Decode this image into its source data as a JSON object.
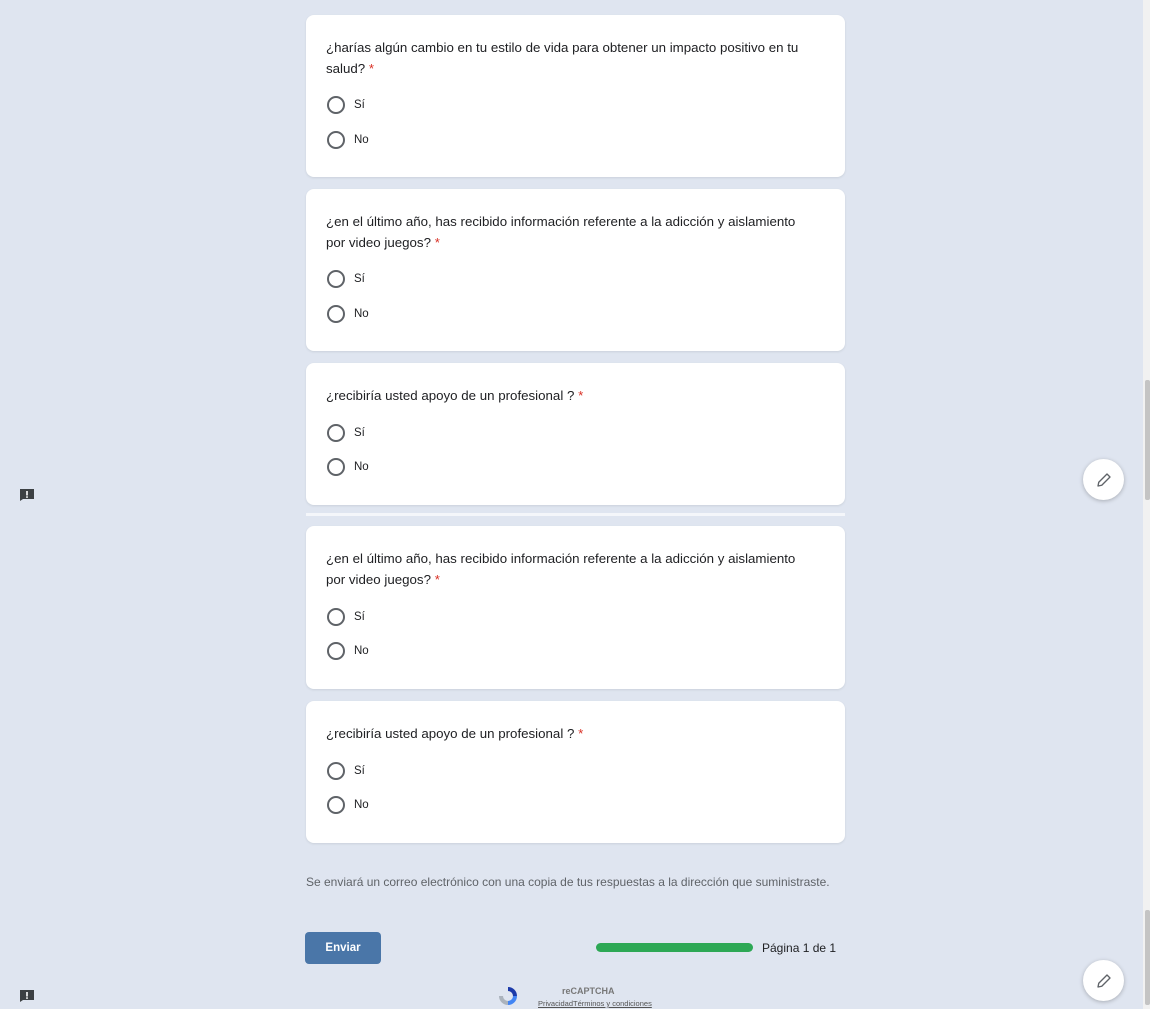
{
  "questions": [
    {
      "title": "¿harías algún cambio en tu estilo de vida para obtener un impacto positivo en tu salud?",
      "required_mark": "*",
      "options": [
        "Sí",
        "No"
      ]
    },
    {
      "title": "¿en el último año, has recibido información referente a la adicción y aislamiento por video juegos?",
      "required_mark": "*",
      "options": [
        "Sí",
        "No"
      ]
    },
    {
      "title": "¿recibiría usted apoyo de un profesional ?",
      "required_mark": "*",
      "options": [
        "Sí",
        "No"
      ]
    },
    {
      "title": "¿en el último año, has recibido información referente a la adicción y aislamiento por video juegos?",
      "required_mark": "*",
      "options": [
        "Sí",
        "No"
      ]
    },
    {
      "title": "¿recibiría usted apoyo de un profesional ?",
      "required_mark": "*",
      "options": [
        "Sí",
        "No"
      ]
    }
  ],
  "footer": {
    "notice": "Se enviará un correo electrónico con una copia de tus respuestas a la dirección que suministraste.",
    "submit_label": "Enviar",
    "progress_fraction": 1.0,
    "page_indicator": "Página 1 de 1"
  },
  "recaptcha": {
    "title": "reCAPTCHA",
    "privacy": "Privacidad",
    "terms": "Términos y condiciones"
  },
  "colors": {
    "background": "#dfe5f0",
    "accent_button": "#4a76a8",
    "progress": "#2da855",
    "required": "#d93025"
  },
  "icons": [
    "pencil-icon",
    "report-icon",
    "recaptcha-icon"
  ]
}
